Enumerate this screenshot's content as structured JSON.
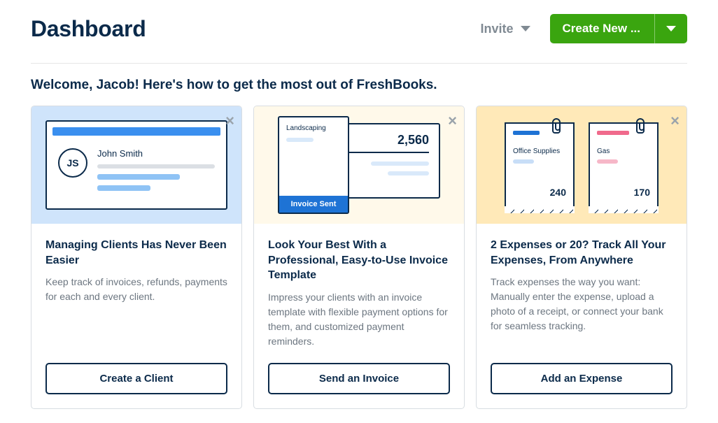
{
  "header": {
    "title": "Dashboard",
    "invite_label": "Invite",
    "create_label": "Create New ..."
  },
  "welcome": "Welcome, Jacob! Here's how to get the most out of FreshBooks.",
  "cards": [
    {
      "illus": {
        "initials": "JS",
        "name": "John Smith"
      },
      "title": "Managing Clients Has Never Been Easier",
      "desc": "Keep track of invoices, refunds, payments for each and every client.",
      "cta": "Create a Client"
    },
    {
      "illus": {
        "label": "Landscaping",
        "amount": "2,560",
        "badge": "Invoice Sent"
      },
      "title": "Look Your Best With a Professional, Easy-to-Use Invoice Template",
      "desc": "Impress your clients with an invoice template with flexible payment options for them, and customized payment reminders.",
      "cta": "Send an Invoice"
    },
    {
      "illus": {
        "r1_label": "Office Supplies",
        "r1_amount": "240",
        "r2_label": "Gas",
        "r2_amount": "170"
      },
      "title": "2 Expenses or 20? Track All Your Expenses, From Anywhere",
      "desc": "Track expenses the way you want: Manually enter the expense, upload a photo of a receipt, or connect your bank for seamless tracking.",
      "cta": "Add an Expense"
    }
  ]
}
